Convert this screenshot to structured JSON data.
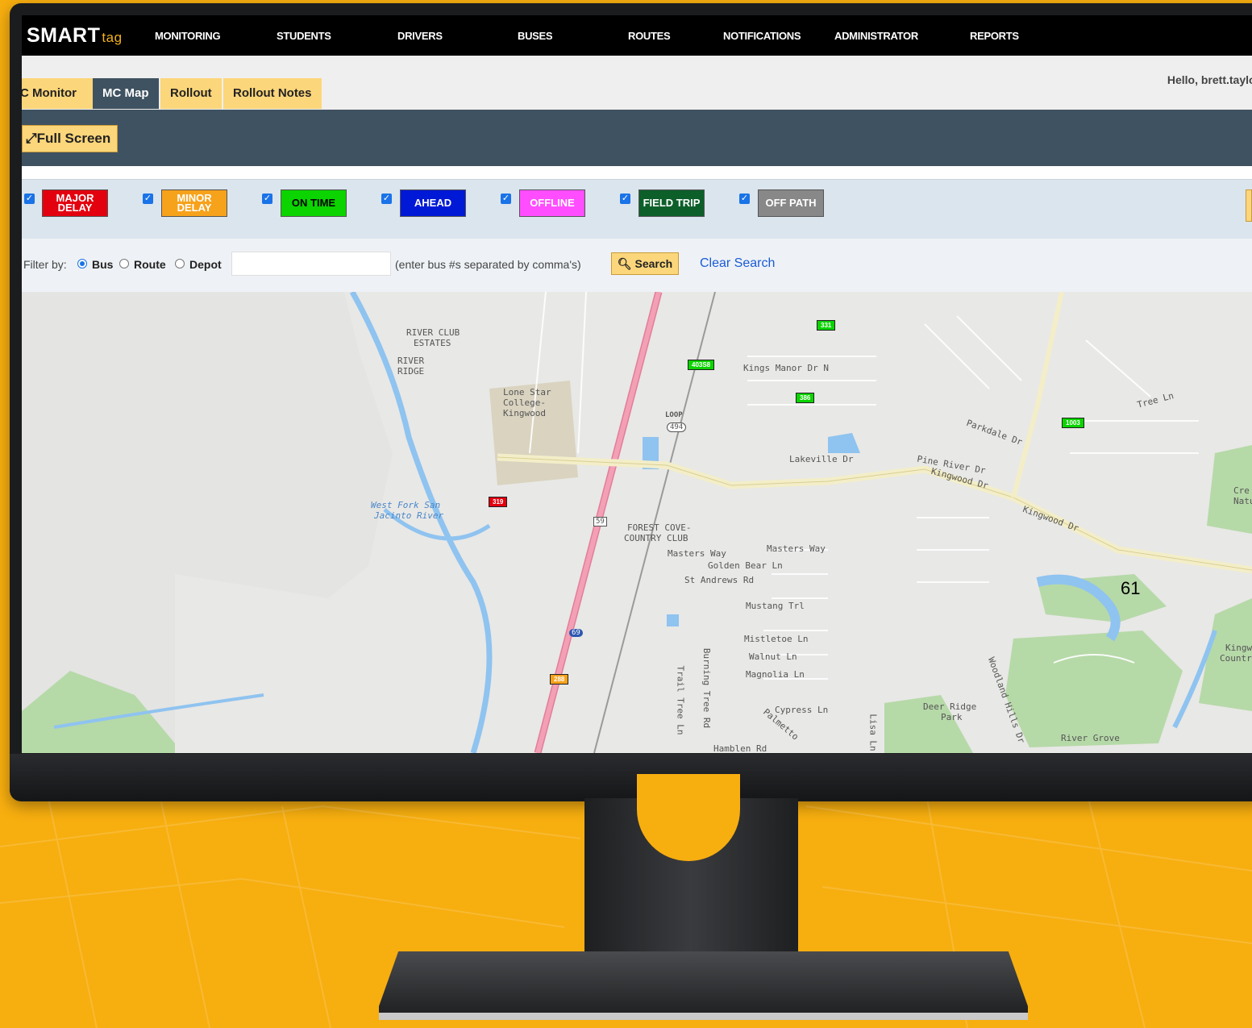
{
  "app": {
    "logo_main": "SMART",
    "logo_tag": "tag"
  },
  "nav": [
    "MONITORING",
    "STUDENTS",
    "DRIVERS",
    "BUSES",
    "ROUTES",
    "NOTIFICATIONS",
    "ADMINISTRATOR",
    "REPORTS"
  ],
  "tabs": [
    "C Monitor",
    "MC Map",
    "Rollout",
    "Rollout Notes"
  ],
  "active_tab": "MC Map",
  "greeting": "Hello, brett.taylor",
  "fullscreen_label": "Full Screen",
  "legend": [
    {
      "label": "MAJOR DELAY",
      "bg": "#e3000f",
      "fg": "#ffffff"
    },
    {
      "label": "MINOR DELAY",
      "bg": "#f7a21b",
      "fg": "#ffffff"
    },
    {
      "label": "ON TIME",
      "bg": "#0bd400",
      "fg": "#000000"
    },
    {
      "label": "AHEAD",
      "bg": "#0019d6",
      "fg": "#ffffff"
    },
    {
      "label": "OFFLINE",
      "bg": "#ff4dff",
      "fg": "#ffffff"
    },
    {
      "label": "FIELD TRIP",
      "bg": "#0d5f2a",
      "fg": "#ffffff"
    },
    {
      "label": "OFF PATH",
      "bg": "#888888",
      "fg": "#ffffff"
    }
  ],
  "filter": {
    "label": "Filter by:",
    "options": [
      "Bus",
      "Route",
      "Depot"
    ],
    "selected": "Bus",
    "input_value": "",
    "hint": "(enter bus #s separated by comma's)",
    "search_label": "Search",
    "clear_label": "Clear Search"
  },
  "map": {
    "labels": [
      "RIVER CLUB",
      "ESTATES",
      "RIVER",
      "RIDGE",
      "Lone Star",
      "College-",
      "Kingwood",
      "West Fork San",
      "Jacinto River",
      "FOREST COVE-",
      "COUNTRY CLUB",
      "Masters Way",
      "Golden Bear Ln",
      "St Andrews Rd",
      "Mustang Trl",
      "Mistletoe Ln",
      "Walnut Ln",
      "Magnolia Ln",
      "Cypress Ln",
      "Kings Manor Dr N",
      "Lakeville Dr",
      "Pine River Dr",
      "Kingwood Dr",
      "Parkdale Dr",
      "Tree Ln",
      "Deer Ridge",
      "Park",
      "River Grove",
      "Kingwood Dr",
      "Trail Tree Ln",
      "Burning Tree Rd",
      "Hamblen Rd",
      "Lisa Ln",
      "Woodland Hills Dr",
      "Masters Way",
      "Palmetto",
      "LOOP",
      "494",
      "59",
      "69",
      "Cre",
      "Natu",
      "Kingw",
      "Countr"
    ],
    "buses": [
      {
        "id": "331",
        "color": "#0bd400"
      },
      {
        "id": "403S8",
        "color": "#0bd400"
      },
      {
        "id": "386",
        "color": "#0bd400"
      },
      {
        "id": "1003",
        "color": "#0bd400"
      },
      {
        "id": "319",
        "color": "#e3000f"
      },
      {
        "id": "288",
        "color": "#f7a21b"
      }
    ],
    "floating_number": "61"
  }
}
